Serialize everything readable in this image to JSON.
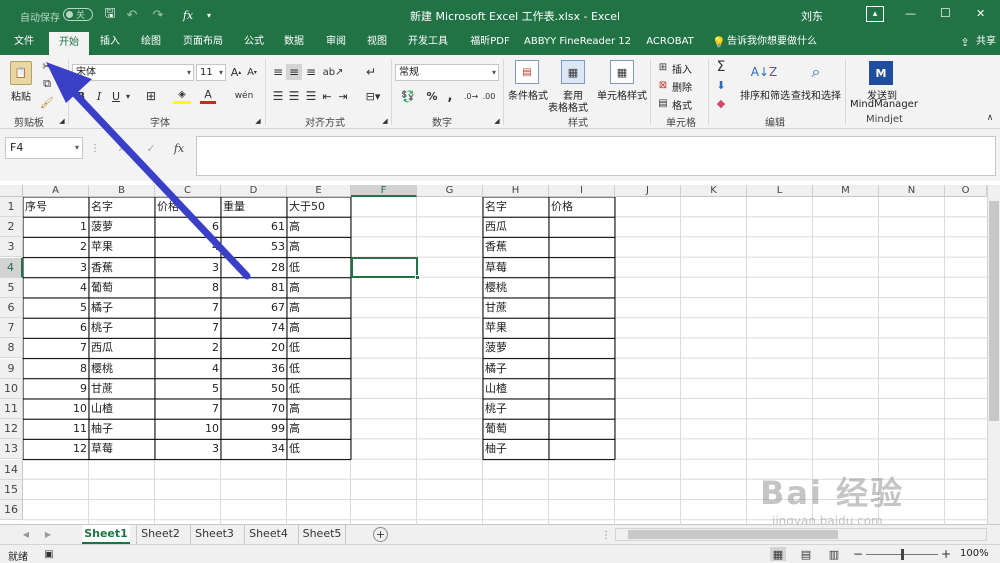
{
  "title_bar": {
    "autosave_label": "自动保存",
    "autosave_state": "关",
    "doc_title": "新建 Microsoft Excel 工作表.xlsx  -  Excel",
    "user": "刘东",
    "minimize": "—",
    "maximize": "☐",
    "close": "✕"
  },
  "tabs": [
    "文件",
    "开始",
    "插入",
    "绘图",
    "页面布局",
    "公式",
    "数据",
    "审阅",
    "视图",
    "开发工具",
    "福昕PDF",
    "ABBYY FineReader 12",
    "ACROBAT"
  ],
  "tell_me": "告诉我你想要做什么",
  "share": "共享",
  "ribbon": {
    "paste": "粘贴",
    "font_name": "宋体",
    "font_size": "11",
    "number_format": "常规",
    "cond_format": "条件格式",
    "table_format_1": "套用",
    "table_format_2": "表格格式",
    "cell_styles": "单元格样式",
    "insert": "插入",
    "delete": "删除",
    "format": "格式",
    "sort_filter": "排序和筛选",
    "find_select": "查找和选择",
    "send_1": "发送到",
    "send_2": "MindManager",
    "groups": {
      "clipboard": "剪贴板",
      "font": "字体",
      "alignment": "对齐方式",
      "number": "数字",
      "styles": "样式",
      "cells": "单元格",
      "editing": "编辑",
      "mindjet": "Mindjet"
    }
  },
  "formula_bar": {
    "name_box": "F4",
    "fx": "fx",
    "formula": ""
  },
  "columns": [
    "A",
    "B",
    "C",
    "D",
    "E",
    "F",
    "G",
    "H",
    "I",
    "J",
    "K",
    "L",
    "M",
    "N",
    "O"
  ],
  "rows": [
    "1",
    "2",
    "3",
    "4",
    "5",
    "6",
    "7",
    "8",
    "9",
    "10",
    "11",
    "12",
    "13",
    "14",
    "15",
    "16"
  ],
  "table1": {
    "headers": [
      "序号",
      "名字",
      "价格",
      "重量",
      "大于50"
    ],
    "rows": [
      [
        "1",
        "菠萝",
        "6",
        "61",
        "高"
      ],
      [
        "2",
        "苹果",
        "4",
        "53",
        "高"
      ],
      [
        "3",
        "香蕉",
        "3",
        "28",
        "低"
      ],
      [
        "4",
        "葡萄",
        "8",
        "81",
        "高"
      ],
      [
        "5",
        "橘子",
        "7",
        "67",
        "高"
      ],
      [
        "6",
        "桃子",
        "7",
        "74",
        "高"
      ],
      [
        "7",
        "西瓜",
        "2",
        "20",
        "低"
      ],
      [
        "8",
        "樱桃",
        "4",
        "36",
        "低"
      ],
      [
        "9",
        "甘蔗",
        "5",
        "50",
        "低"
      ],
      [
        "10",
        "山楂",
        "7",
        "70",
        "高"
      ],
      [
        "11",
        "柚子",
        "10",
        "99",
        "高"
      ],
      [
        "12",
        "草莓",
        "3",
        "34",
        "低"
      ]
    ]
  },
  "table2": {
    "headers": [
      "名字",
      "价格"
    ],
    "names": [
      "西瓜",
      "香蕉",
      "草莓",
      "樱桃",
      "甘蔗",
      "苹果",
      "菠萝",
      "橘子",
      "山楂",
      "桃子",
      "葡萄",
      "柚子"
    ]
  },
  "sheets": [
    "Sheet1",
    "Sheet2",
    "Sheet3",
    "Sheet4",
    "Sheet5"
  ],
  "active_sheet": "Sheet1",
  "status": {
    "ready": "就绪",
    "zoom": "100%"
  },
  "watermark": {
    "brand": "Bai 经验",
    "url": "jingyan.baidu.com"
  },
  "colors": {
    "excel_green": "#217346",
    "arrow": "#3a3fc8",
    "selection": "#217346"
  }
}
